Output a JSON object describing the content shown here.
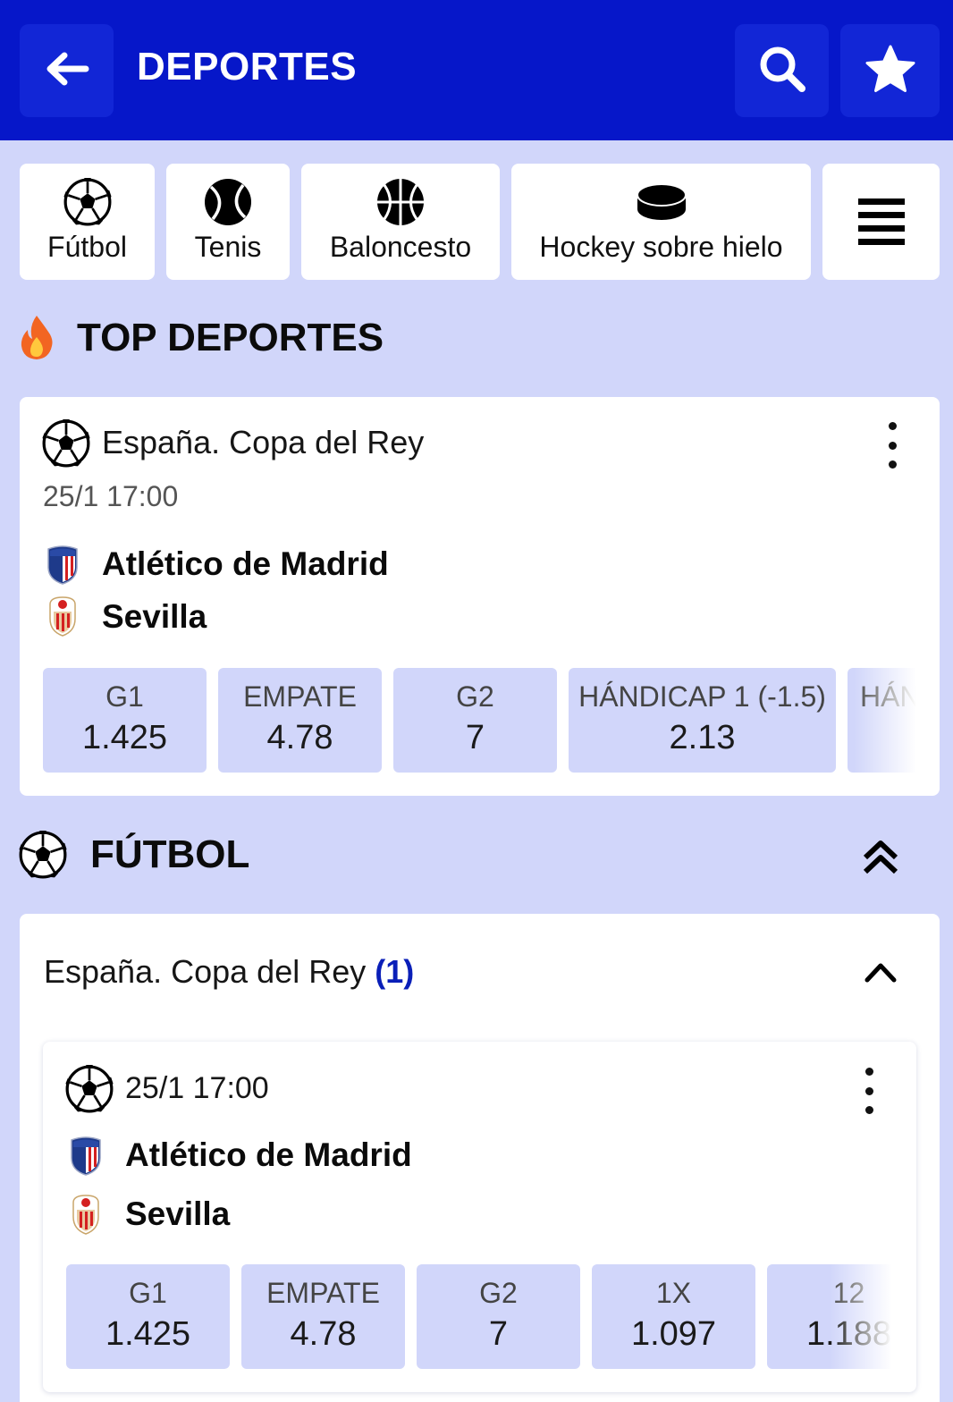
{
  "header": {
    "title": "DEPORTES"
  },
  "sports_tabs": [
    {
      "label": "Fútbol",
      "icon": "soccer-ball-icon"
    },
    {
      "label": "Tenis",
      "icon": "tennis-ball-icon"
    },
    {
      "label": "Baloncesto",
      "icon": "basketball-icon"
    },
    {
      "label": "Hockey sobre hielo",
      "icon": "hockey-puck-icon"
    }
  ],
  "top_section": {
    "title": "TOP DEPORTES",
    "match": {
      "league": "España. Copa del Rey",
      "datetime": "25/1 17:00",
      "team1": "Atlético de Madrid",
      "team2": "Sevilla",
      "odds": [
        {
          "label": "G1",
          "value": "1.425"
        },
        {
          "label": "EMPATE",
          "value": "4.78"
        },
        {
          "label": "G2",
          "value": "7"
        },
        {
          "label": "HÁNDICAP 1 (-1.5)",
          "value": "2.13"
        },
        {
          "label": "HÁN",
          "value": ""
        }
      ]
    }
  },
  "football_section": {
    "title": "FÚTBOL",
    "league": {
      "name": "España. Copa del Rey",
      "count": "(1)"
    },
    "match": {
      "datetime": "25/1 17:00",
      "team1": "Atlético de Madrid",
      "team2": "Sevilla",
      "odds": [
        {
          "label": "G1",
          "value": "1.425"
        },
        {
          "label": "EMPATE",
          "value": "4.78"
        },
        {
          "label": "G2",
          "value": "7"
        },
        {
          "label": "1X",
          "value": "1.097"
        },
        {
          "label": "12",
          "value": "1.188"
        }
      ]
    }
  },
  "colors": {
    "header": "#0617c9",
    "background": "#d1d6fa",
    "accent": "#0a1fb8"
  }
}
